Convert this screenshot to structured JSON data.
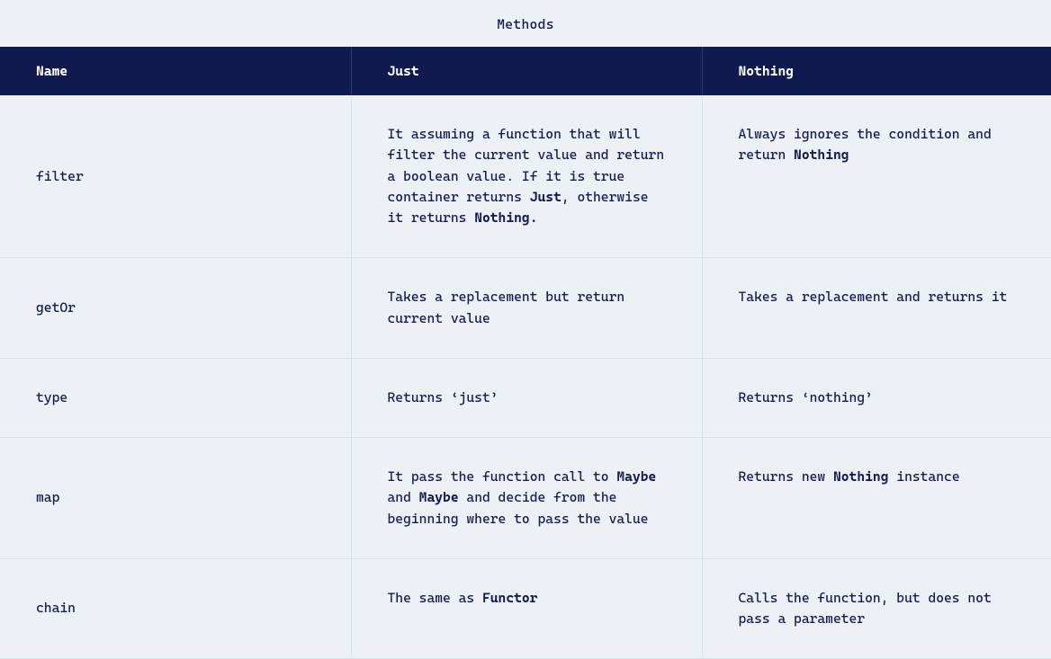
{
  "caption": "Methods",
  "columns": {
    "name": "Name",
    "just": "Just",
    "nothing": "Nothing"
  },
  "rows": [
    {
      "name": "filter",
      "just_segments": [
        {
          "text": "It assuming a function that will filter the current value and return a boolean value. If it is true container returns ",
          "bold": false
        },
        {
          "text": "Just",
          "bold": true
        },
        {
          "text": ", otherwise it returns ",
          "bold": false
        },
        {
          "text": "Nothing.",
          "bold": true
        }
      ],
      "nothing_segments": [
        {
          "text": "Always ignores the condition and return ",
          "bold": false
        },
        {
          "text": "Nothing",
          "bold": true
        }
      ]
    },
    {
      "name": "getOr",
      "just_segments": [
        {
          "text": "Takes a replacement but return current value",
          "bold": false
        }
      ],
      "nothing_segments": [
        {
          "text": "Takes a replacement and returns it",
          "bold": false
        }
      ]
    },
    {
      "name": "type",
      "just_segments": [
        {
          "text": "Returns ‘just’",
          "bold": false
        }
      ],
      "nothing_segments": [
        {
          "text": "Returns ‘nothing’",
          "bold": false
        }
      ]
    },
    {
      "name": "map",
      "just_segments": [
        {
          "text": "It pass the function call to ",
          "bold": false
        },
        {
          "text": "Maybe",
          "bold": true
        },
        {
          "text": " and ",
          "bold": false
        },
        {
          "text": "Maybe",
          "bold": true
        },
        {
          "text": " and decide from the beginning where to pass the value",
          "bold": false
        }
      ],
      "nothing_segments": [
        {
          "text": "Returns new ",
          "bold": false
        },
        {
          "text": "Nothing",
          "bold": true
        },
        {
          "text": " instance",
          "bold": false
        }
      ]
    },
    {
      "name": "chain",
      "just_segments": [
        {
          "text": "The same as ",
          "bold": false
        },
        {
          "text": "Functor",
          "bold": true
        }
      ],
      "nothing_segments": [
        {
          "text": "Calls the function, but does not pass a parameter",
          "bold": false
        }
      ]
    }
  ]
}
